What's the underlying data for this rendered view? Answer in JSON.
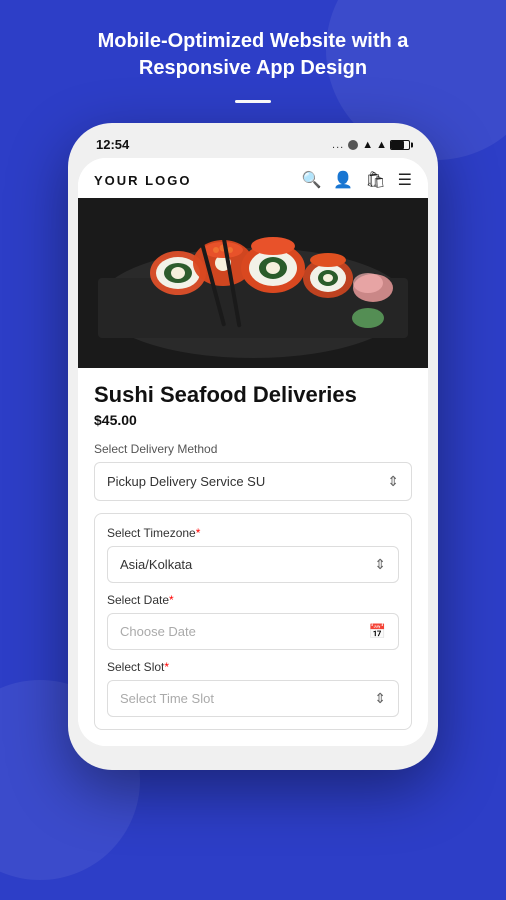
{
  "page": {
    "background_color": "#2d3ec7",
    "header": {
      "title": "Mobile-Optimized Website with a Responsive App Design"
    }
  },
  "phone": {
    "time": "12:54",
    "status_dots": "...",
    "app": {
      "logo": "YOUR LOGO",
      "nav_icons": [
        "search",
        "user",
        "bag",
        "menu"
      ],
      "product": {
        "title": "Sushi Seafood Deliveries",
        "price": "$45.00",
        "delivery_method_label": "Select Delivery Method",
        "delivery_method_value": "Pickup Delivery Service SU",
        "form": {
          "timezone_label": "Select Timezone",
          "timezone_required": true,
          "timezone_value": "Asia/Kolkata",
          "date_label": "Select Date",
          "date_required": true,
          "date_placeholder": "Choose Date",
          "slot_label": "Select Slot",
          "slot_required": true,
          "slot_placeholder": "Select Time Slot"
        }
      }
    }
  }
}
